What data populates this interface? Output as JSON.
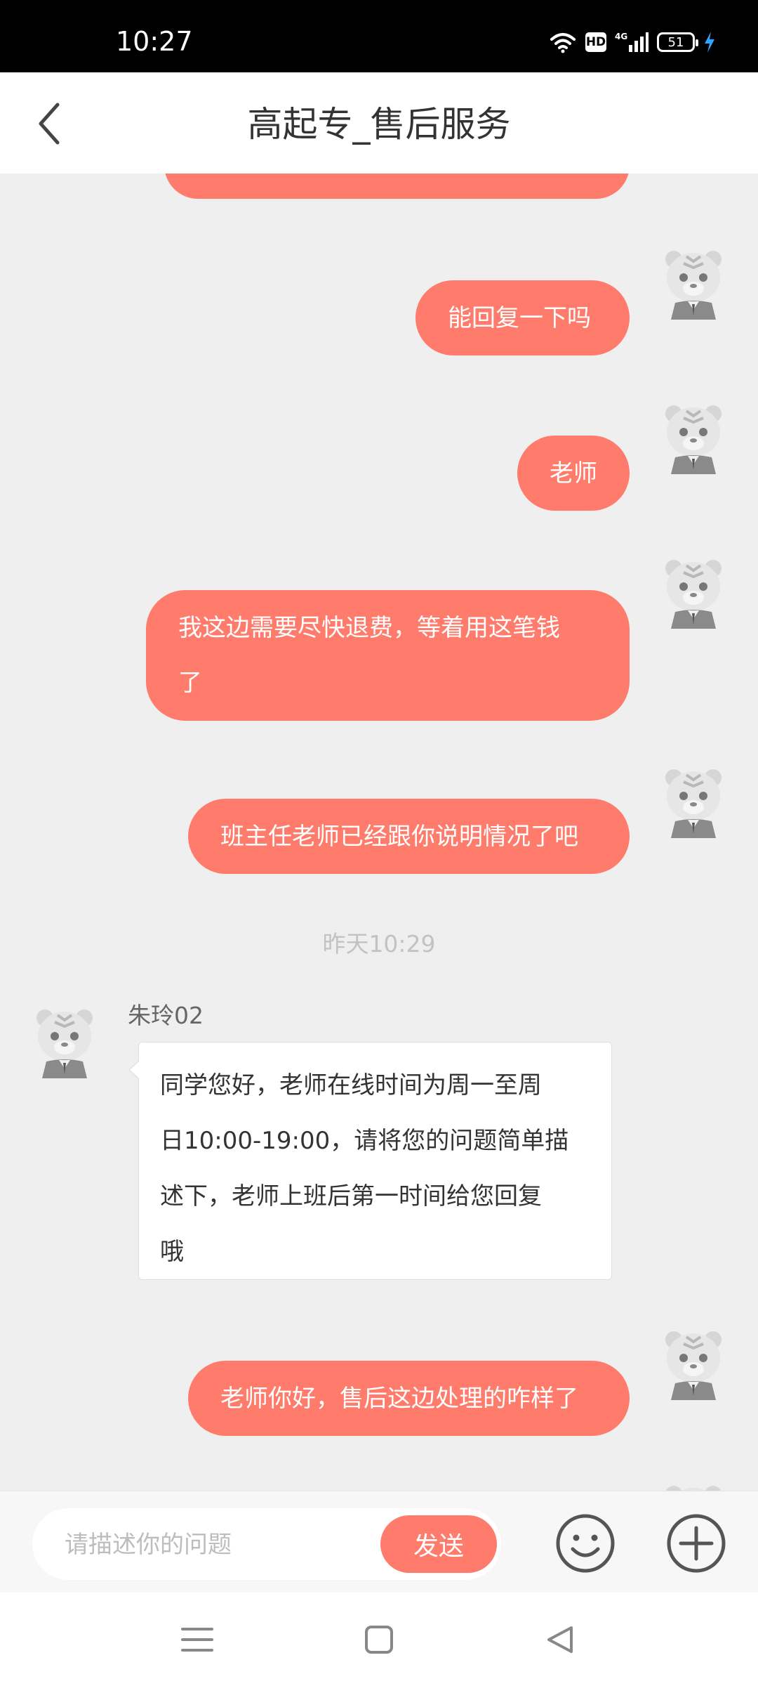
{
  "status_bar": {
    "time": "10:27",
    "hd": "HD",
    "network": "4G",
    "battery": "51"
  },
  "header": {
    "title": "高起专_售后服务"
  },
  "messages": {
    "m0": {
      "text": ""
    },
    "m1": {
      "text": "能回复一下吗"
    },
    "m2": {
      "text": "老师"
    },
    "m3": {
      "line1": "我这边需要尽快退费，等着用这笔钱",
      "line2": "了"
    },
    "m4": {
      "text": "班主任老师已经跟你说明情况了吧"
    },
    "timestamp": "昨天10:29",
    "incoming": {
      "sender": "朱玲02",
      "line1": "同学您好，老师在线时间为周一至周",
      "line2": "日10:00-19:00，请将您的问题简单描",
      "line3": "述下，老师上班后第一时间给您回复",
      "line4": "哦"
    },
    "m5": {
      "text": "老师你好，售后这边处理的咋样了"
    }
  },
  "input": {
    "placeholder": "请描述你的问题",
    "send_label": "发送"
  },
  "colors": {
    "accent": "#ff7b6b",
    "background": "#efefef"
  }
}
